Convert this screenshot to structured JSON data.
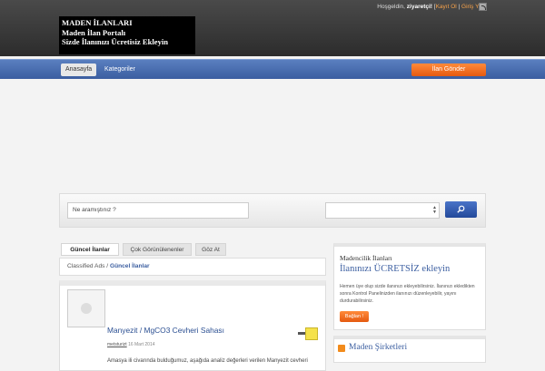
{
  "header": {
    "greeting_prefix": "Hoşgeldin,",
    "username": "ziyaretçi!",
    "bracket_open": "[",
    "register": "Kayıt Ol",
    "sep": "|",
    "login": "Giriş Yap",
    "bracket_close": "]",
    "logo_lines": [
      "MADEN İLANLARI",
      "Maden İlan Portalı",
      "Sizde İlanınızı Ücretisiz Ekleyin"
    ]
  },
  "nav": {
    "items": [
      "Anasayfa",
      "Kategoriler"
    ],
    "post_ad": "İlan Gönder"
  },
  "search": {
    "placeholder": "Ne aramıştınız ?",
    "select_value": "",
    "button_icon": "search-icon"
  },
  "tabs": [
    "Güncel İlanlar",
    "Çok Görünülenenler",
    "Göz At"
  ],
  "breadcrumb": {
    "root": "Classified Ads",
    "sep": "/",
    "current": "Güncel İlanlar"
  },
  "listing": {
    "title": "Manyezit / MgCO3 Cevheri Sahası",
    "author": "metsturizt",
    "date": "16 Mart 2014",
    "description": "Amasya ili civarında bulduğumuz, aşağıda analiz değerleri verilen Manyezit cevheri"
  },
  "sidebar": {
    "title": "Madencilik İlanları",
    "subtitle": "İlanınızı ÜCRETSİZ ekleyin",
    "text": "Hemen üye olup sizde ilanınızı ekleyebilirsiniz. İlanınızı ekledikten sonra Kontrol Panelinizden ilanınızı düzenleyebilir, yayını durdurabilirsiniz.",
    "button": "Bağlan !"
  },
  "companies": {
    "title": "Maden Şirketleri"
  },
  "colors": {
    "accent": "#3b5ea0",
    "button_orange": "#f07022",
    "header_dark": "#333333"
  }
}
